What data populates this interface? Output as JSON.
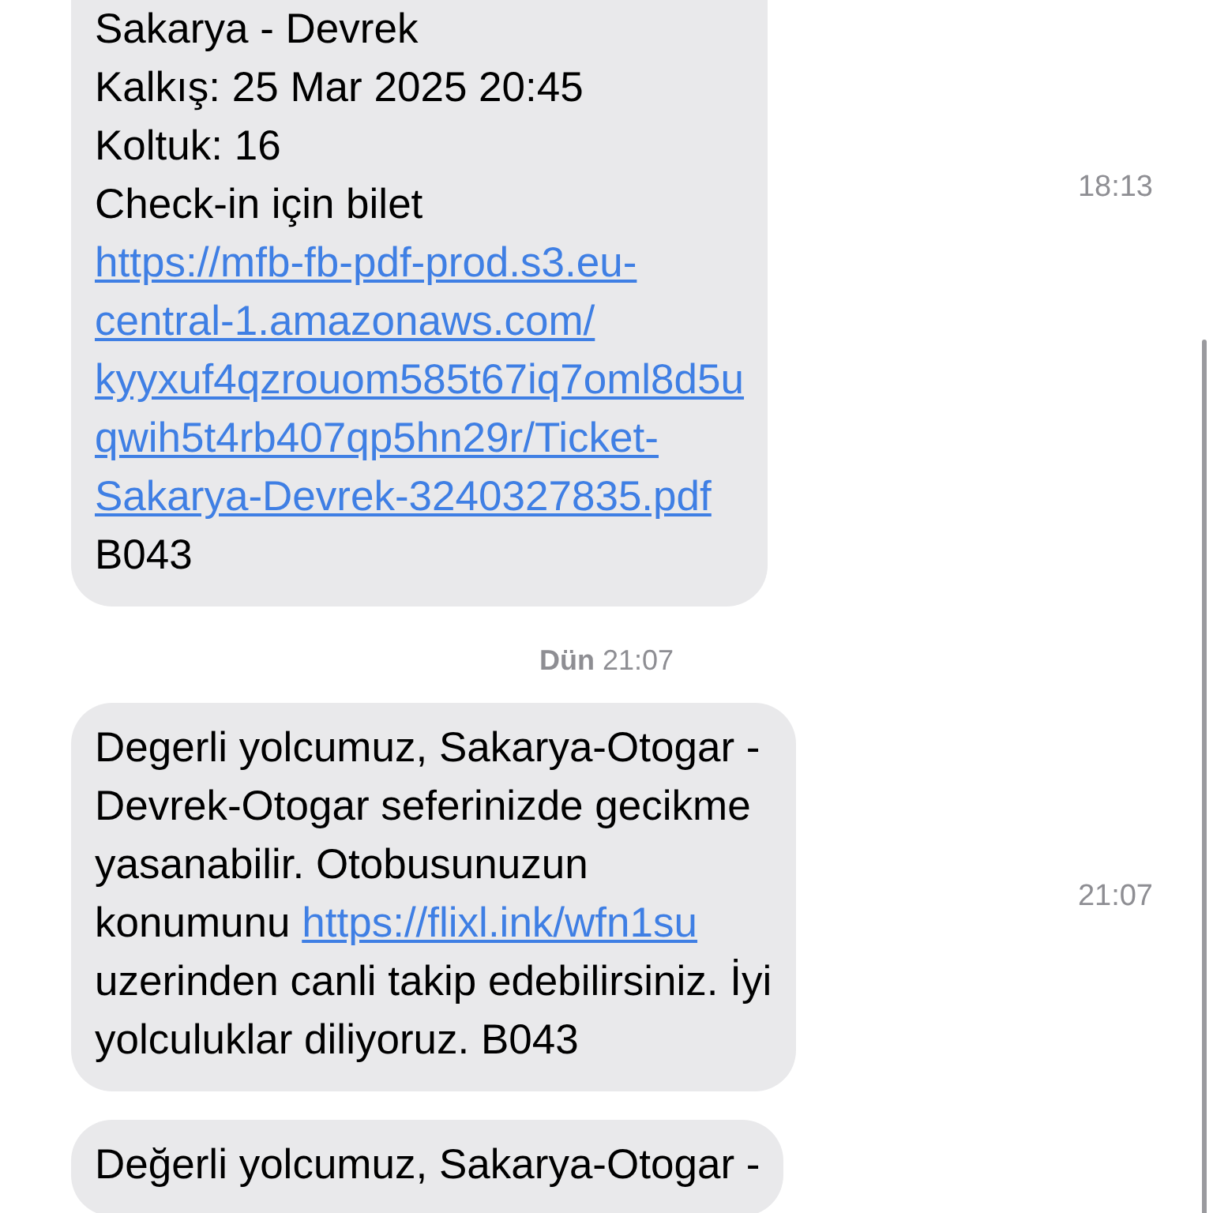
{
  "conversation": [
    {
      "kind": "message",
      "time": "18:13",
      "lines": [
        [
          {
            "kind": "text",
            "text": "Sakarya - Devrek"
          }
        ],
        [
          {
            "kind": "text",
            "text": "Kalkış: 25 Mar 2025 20:45"
          }
        ],
        [
          {
            "kind": "text",
            "text": "Koltuk: 16"
          }
        ],
        [
          {
            "kind": "text",
            "text": "Check-in için bilet"
          }
        ],
        [
          {
            "kind": "link",
            "text": "https://mfb-fb-pdf-prod.s3.eu-"
          }
        ],
        [
          {
            "kind": "link",
            "text": "central-1.amazonaws.com/"
          }
        ],
        [
          {
            "kind": "link",
            "text": "kyyxuf4qzrouom585t67iq7oml8d5u"
          }
        ],
        [
          {
            "kind": "link",
            "text": "qwih5t4rb407qp5hn29r/Ticket-"
          }
        ],
        [
          {
            "kind": "link",
            "text": "Sakarya-Devrek-3240327835.pdf"
          }
        ],
        [
          {
            "kind": "text",
            "text": "B043"
          }
        ]
      ]
    },
    {
      "kind": "date",
      "label": "**Dün** 21:07"
    },
    {
      "kind": "message",
      "time": "21:07",
      "lines": [
        [
          {
            "kind": "text",
            "text": "Degerli yolcumuz, Sakarya-Otogar -"
          }
        ],
        [
          {
            "kind": "text",
            "text": "Devrek-Otogar seferinizde gecikme"
          }
        ],
        [
          {
            "kind": "text",
            "text": "yasanabilir. Otobusunuzun"
          }
        ],
        [
          {
            "kind": "text",
            "text": "konumunu "
          },
          {
            "kind": "link",
            "text": "https://flixl.ink/wfn1su"
          }
        ],
        [
          {
            "kind": "text",
            "text": "uzerinden canli takip edebilirsiniz. İyi"
          }
        ],
        [
          {
            "kind": "text",
            "text": "yolculuklar diliyoruz. B043"
          }
        ]
      ]
    },
    {
      "kind": "message",
      "lines": [
        [
          {
            "kind": "text",
            "text": "Değerli yolcumuz, Sakarya-Otogar -"
          }
        ]
      ]
    }
  ]
}
